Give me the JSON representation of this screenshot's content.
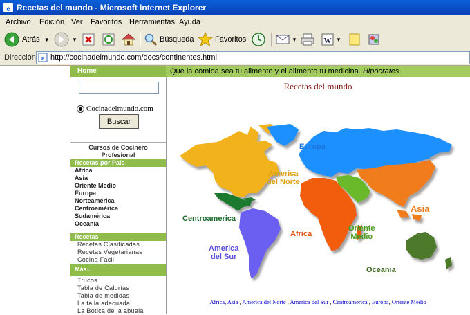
{
  "window": {
    "title": "Recetas del mundo - Microsoft Internet Explorer"
  },
  "menu": [
    "Archivo",
    "Edición",
    "Ver",
    "Favoritos",
    "Herramientas",
    "Ayuda"
  ],
  "toolbar": {
    "back_label": "Atrás",
    "search_label": "Búsqueda",
    "favorites_label": "Favoritos"
  },
  "address": {
    "label": "Dirección",
    "url": "http://cocinadelmundo.com/docs/continentes.html"
  },
  "sidebar": {
    "home": "Home",
    "search_value": "",
    "radio_label": "Cocinadelmundo.com",
    "search_button": "Buscar",
    "cursos": [
      "Cursos de Cocinero",
      "Profesional"
    ],
    "recetas_por_pais_header": "Recetas por País",
    "paises": [
      "Africa",
      "Asia",
      "Oriente Medio",
      "Europa",
      "Norteamérica",
      "Centroamérica",
      "Sudamérica",
      "Oceanía"
    ],
    "recetas_header": "Recetas",
    "recetas": [
      "Recetas Clasificadas",
      "Recetas Vegetarianas",
      "Cocina Fácil"
    ],
    "mas_header": "Más...",
    "mas": [
      "Trucos",
      "Tabla de Calorías",
      "Tabla de medidas",
      "La talla adecuada",
      "La Botica de la abuela"
    ]
  },
  "main": {
    "quote": "Que la comida sea tu alimento y el alimento tu medicina.",
    "quote_author": "Hipócrates",
    "title": "Recetas del mundo",
    "map_labels": {
      "europa": "Europa",
      "america_norte_1": "America",
      "america_norte_2": "del Norte",
      "asia": "Asia",
      "centroamerica": "Centroamerica",
      "africa": "Africa",
      "oriente_1": "Oriente",
      "oriente_2": "Medio",
      "america_sur_1": "America",
      "america_sur_2": "del Sur",
      "oceania": "Oceania"
    },
    "links": [
      "Africa",
      "Asia",
      "America del Norte",
      "America del Sur",
      "Centroamerica",
      "Europa",
      "Oriente Medio"
    ]
  },
  "colors": {
    "title_bar": "#0a5fd8",
    "green_bar": "#8fbc4a",
    "north_america": "#f2b21c",
    "europe": "#1e90ff",
    "asia": "#f07c1e",
    "africa": "#f25d0f",
    "middle_east": "#6ab92c",
    "south_america": "#6a5ff0",
    "central_america": "#1e7a2e",
    "oceania": "#4e7a2a"
  }
}
